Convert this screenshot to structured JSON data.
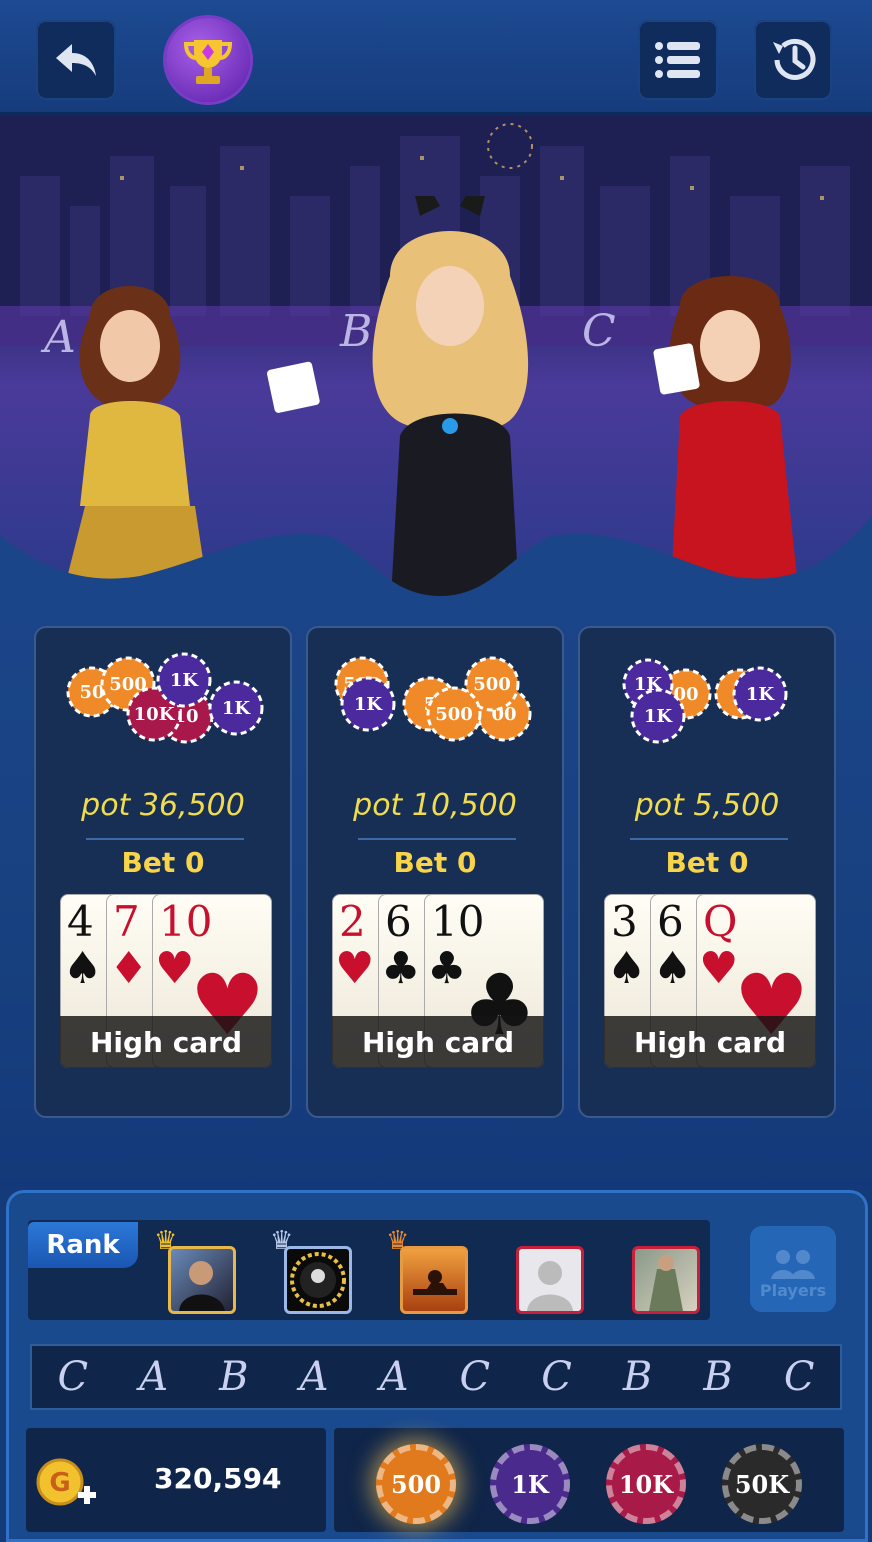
{
  "header": {
    "back_icon": "back-arrow-icon",
    "trophy_icon": "trophy-icon",
    "menu_icon": "menu-list-icon",
    "history_icon": "history-clock-icon"
  },
  "stage": {
    "letters": [
      "A",
      "B",
      "C"
    ]
  },
  "pots": [
    {
      "chips": [
        "50",
        "500",
        "1K",
        "10K",
        "10",
        "1K"
      ],
      "pot_label": "pot  36,500",
      "bet_label": "Bet  0",
      "cards": [
        {
          "rank": "4",
          "suit": "♠",
          "color": "#111"
        },
        {
          "rank": "7",
          "suit": "♦",
          "color": "#c8102e"
        },
        {
          "rank": "10",
          "suit": "♥",
          "color": "#c8102e"
        }
      ],
      "hand_label": "High card"
    },
    {
      "chips": [
        "500",
        "1K",
        "5",
        "500",
        "500",
        "00"
      ],
      "pot_label": "pot  10,500",
      "bet_label": "Bet  0",
      "cards": [
        {
          "rank": "2",
          "suit": "♥",
          "color": "#c8102e"
        },
        {
          "rank": "6",
          "suit": "♣",
          "color": "#111"
        },
        {
          "rank": "10",
          "suit": "♣",
          "color": "#111"
        }
      ],
      "hand_label": "High card"
    },
    {
      "chips": [
        "1K",
        "1K",
        "00",
        "5",
        "1K"
      ],
      "pot_label": "pot  5,500",
      "bet_label": "Bet  0",
      "cards": [
        {
          "rank": "3",
          "suit": "♠",
          "color": "#111"
        },
        {
          "rank": "6",
          "suit": "♠",
          "color": "#111"
        },
        {
          "rank": "Q",
          "suit": "♥",
          "color": "#c8102e"
        }
      ],
      "hand_label": "High card"
    }
  ],
  "rank_panel": {
    "label": "Rank",
    "players_label": "Players",
    "avatars": [
      {
        "border": "#e8b84a",
        "crown": "#f0c030"
      },
      {
        "border": "#9ab8e8",
        "crown": "#b8c8e8"
      },
      {
        "border": "#e89a40",
        "crown": "#e88a30"
      },
      {
        "border": "#c8203a",
        "crown": ""
      },
      {
        "border": "#c8203a",
        "crown": ""
      }
    ]
  },
  "history": [
    "C",
    "A",
    "B",
    "A",
    "A",
    "C",
    "C",
    "B",
    "B",
    "C"
  ],
  "balance": {
    "value": "320,594",
    "coin_icon": "gold-coin-add-icon"
  },
  "bet_chips": [
    {
      "label": "500",
      "color": "#e07a1c"
    },
    {
      "label": "1K",
      "color": "#4a2a8c"
    },
    {
      "label": "10K",
      "color": "#a81a48"
    },
    {
      "label": "50K",
      "color": "#2a2a2a"
    }
  ],
  "colors": {
    "accent": "#f0dc4e",
    "panel": "#172e55",
    "background": "#143a78"
  }
}
